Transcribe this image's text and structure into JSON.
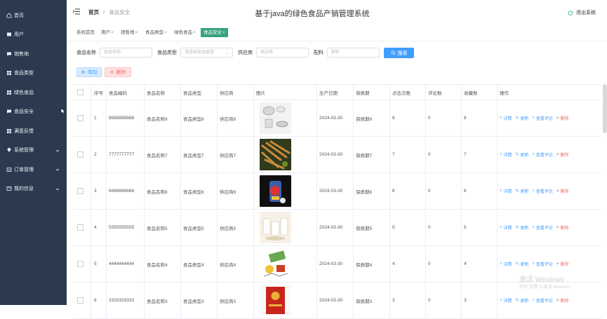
{
  "sidebar": {
    "items": [
      {
        "label": "首页",
        "icon": "home-icon"
      },
      {
        "label": "用户",
        "icon": "user-icon"
      },
      {
        "label": "销售地",
        "icon": "message-icon"
      },
      {
        "label": "食品类型",
        "icon": "grid-icon"
      },
      {
        "label": "绿色食品",
        "icon": "grid-icon"
      },
      {
        "label": "食品安全",
        "icon": "message-icon"
      },
      {
        "label": "满意反馈",
        "icon": "grid-icon"
      },
      {
        "label": "系统管理",
        "icon": "pin-icon",
        "expandable": true
      },
      {
        "label": "订单管理",
        "icon": "list-icon",
        "expandable": true
      },
      {
        "label": "我的信息",
        "icon": "doc-icon",
        "expandable": true
      }
    ]
  },
  "header": {
    "breadcrumb_home": "首页",
    "breadcrumb_sep": "/",
    "breadcrumb_current": "食品安全",
    "title": "基于java的绿色食品产销管理系统",
    "logout": "退出系统"
  },
  "tabs": [
    {
      "label": "系统首页",
      "closable": false
    },
    {
      "label": "用户",
      "closable": true
    },
    {
      "label": "销售地",
      "closable": true
    },
    {
      "label": "食品类型",
      "closable": true
    },
    {
      "label": "绿色食品",
      "closable": true
    },
    {
      "label": "食品安全",
      "closable": true,
      "active": true
    }
  ],
  "search": {
    "name_label": "食品名称",
    "name_placeholder": "食品名称",
    "type_label": "食品类型",
    "type_placeholder": "请选择食品类型",
    "supplier_label": "供应商",
    "supplier_placeholder": "供应商",
    "ingredient_label": "配料",
    "ingredient_placeholder": "配料",
    "search_button": "搜索"
  },
  "actions": {
    "add": "增加",
    "delete": "删除"
  },
  "table": {
    "columns": [
      "序号",
      "食品编码",
      "食品名称",
      "食品类型",
      "供应商",
      "图片",
      "生产日期",
      "保质期",
      "点击次数",
      "评论数",
      "收藏数",
      "操作"
    ],
    "op_labels": {
      "detail": "详情",
      "edit": "更新",
      "review": "查看评论",
      "delete": "删除"
    },
    "rows": [
      {
        "no": "1",
        "code": "8888888888",
        "name": "食品名称8",
        "type": "食品类型8",
        "supplier": "供应商8",
        "date": "2024-03-30",
        "shelf": "保质期8",
        "clicks": "8",
        "comments": "0",
        "favs": "8"
      },
      {
        "no": "2",
        "code": "7777777777",
        "name": "食品名称7",
        "type": "食品类型7",
        "supplier": "供应商7",
        "date": "2024-03-30",
        "shelf": "保质期7",
        "clicks": "7",
        "comments": "0",
        "favs": "7"
      },
      {
        "no": "3",
        "code": "6666666666",
        "name": "食品名称6",
        "type": "食品类型6",
        "supplier": "供应商6",
        "date": "2024-03-30",
        "shelf": "保质期6",
        "clicks": "6",
        "comments": "0",
        "favs": "6"
      },
      {
        "no": "4",
        "code": "5555555555",
        "name": "食品名称5",
        "type": "食品类型5",
        "supplier": "供应商5",
        "date": "2024-03-30",
        "shelf": "保质期5",
        "clicks": "5",
        "comments": "0",
        "favs": "5"
      },
      {
        "no": "5",
        "code": "4444444444",
        "name": "食品名称4",
        "type": "食品类型4",
        "supplier": "供应商4",
        "date": "2024-03-30",
        "shelf": "保质期4",
        "clicks": "4",
        "comments": "0",
        "favs": "4"
      },
      {
        "no": "6",
        "code": "3333333333",
        "name": "食品名称3",
        "type": "食品类型3",
        "supplier": "供应商3",
        "date": "2024-03-30",
        "shelf": "保质期3",
        "clicks": "3",
        "comments": "0",
        "favs": "3"
      }
    ]
  },
  "watermark": {
    "line1": "激活 Windows",
    "line2": "转到\"设置\"以激活 Windows。"
  },
  "colors": {
    "sidebar_bg": "#2b3a4f",
    "active_tab": "#37a37c",
    "primary": "#409eff",
    "danger": "#f56c6c"
  }
}
